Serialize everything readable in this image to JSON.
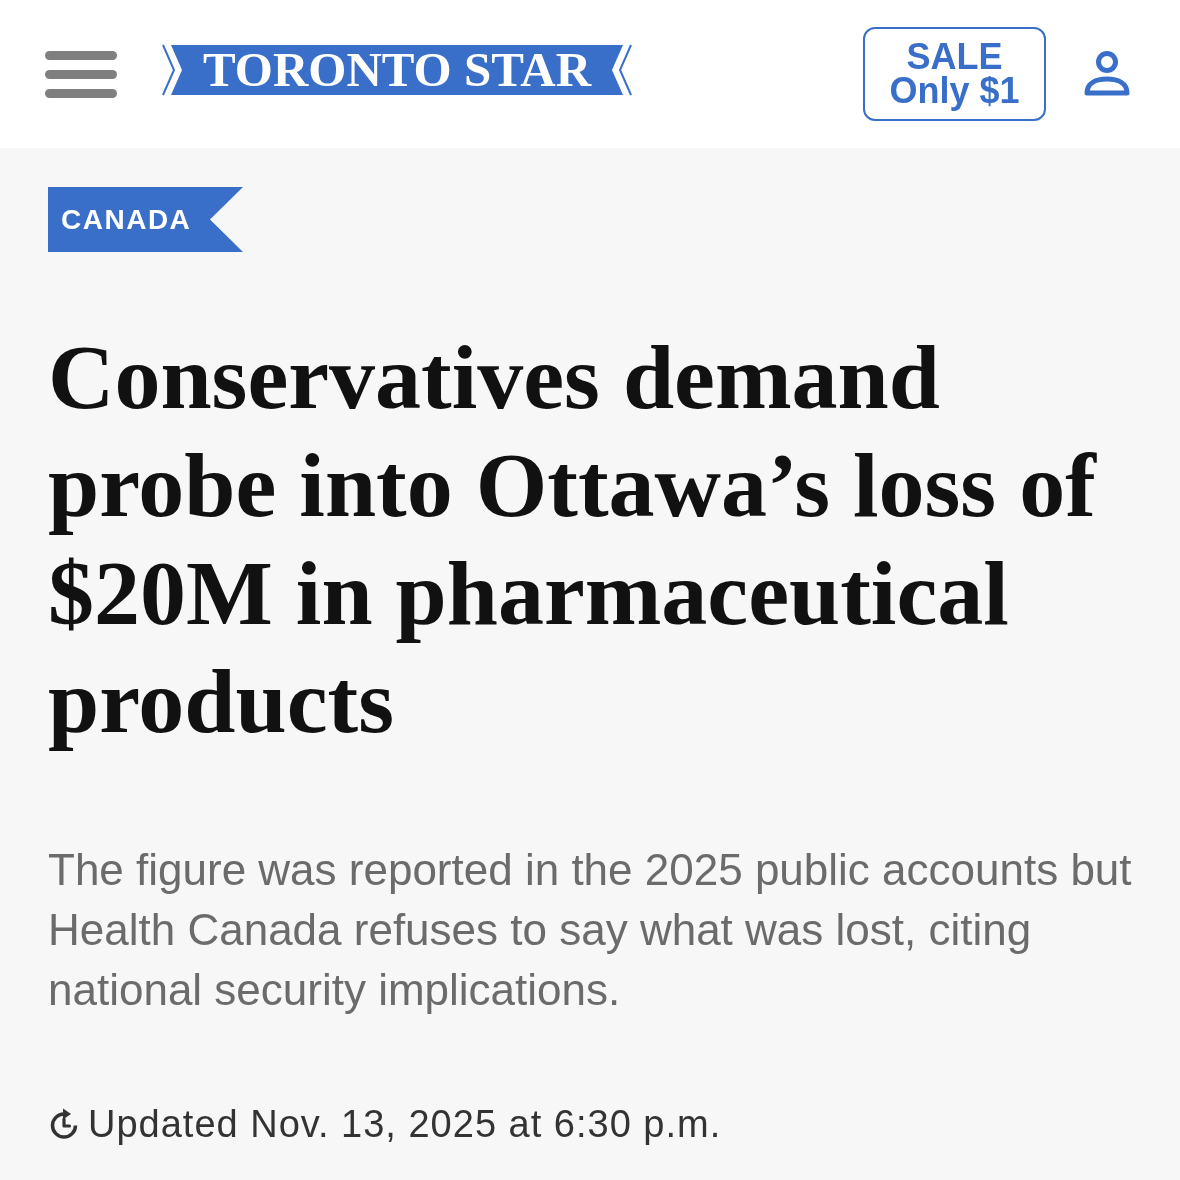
{
  "header": {
    "logo": "TORONTO STAR",
    "sale_button": {
      "lines": [
        "SALE",
        "Only $1"
      ]
    }
  },
  "article": {
    "category": "CANADA",
    "headline": "Conservatives demand probe into Ottawa’s loss of $20M in pharmaceutical products",
    "summary": "The figure was reported in the 2025 public accounts but Health Canada refuses to say what was lost, citing national security implications.",
    "updated": "Updated Nov. 13, 2025 at 6:30 p.m."
  }
}
